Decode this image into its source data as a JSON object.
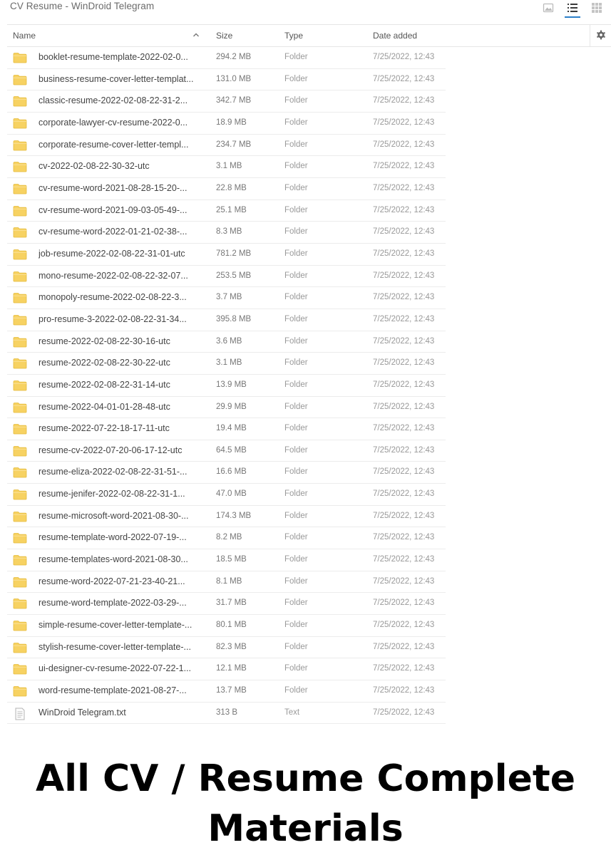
{
  "window": {
    "title": "CV Resume - WinDroid Telegram"
  },
  "toolbar": {
    "icons": [
      "image-view-icon",
      "list-view-icon",
      "grid-view-icon"
    ],
    "active_view": "list"
  },
  "table": {
    "headers": {
      "name": "Name",
      "size": "Size",
      "type": "Type",
      "date": "Date added"
    },
    "sort": "name-ascending",
    "rows": [
      {
        "name": "booklet-resume-template-2022-02-0...",
        "size": "294.2 MB",
        "type": "Folder",
        "date": "7/25/2022, 12:43",
        "icon": "folder-icon"
      },
      {
        "name": "business-resume-cover-letter-templat...",
        "size": "131.0 MB",
        "type": "Folder",
        "date": "7/25/2022, 12:43",
        "icon": "folder-icon"
      },
      {
        "name": "classic-resume-2022-02-08-22-31-2...",
        "size": "342.7 MB",
        "type": "Folder",
        "date": "7/25/2022, 12:43",
        "icon": "folder-icon"
      },
      {
        "name": "corporate-lawyer-cv-resume-2022-0...",
        "size": "18.9 MB",
        "type": "Folder",
        "date": "7/25/2022, 12:43",
        "icon": "folder-icon"
      },
      {
        "name": "corporate-resume-cover-letter-templ...",
        "size": "234.7 MB",
        "type": "Folder",
        "date": "7/25/2022, 12:43",
        "icon": "folder-icon"
      },
      {
        "name": "cv-2022-02-08-22-30-32-utc",
        "size": "3.1 MB",
        "type": "Folder",
        "date": "7/25/2022, 12:43",
        "icon": "folder-icon"
      },
      {
        "name": "cv-resume-word-2021-08-28-15-20-...",
        "size": "22.8 MB",
        "type": "Folder",
        "date": "7/25/2022, 12:43",
        "icon": "folder-icon"
      },
      {
        "name": "cv-resume-word-2021-09-03-05-49-...",
        "size": "25.1 MB",
        "type": "Folder",
        "date": "7/25/2022, 12:43",
        "icon": "folder-icon"
      },
      {
        "name": "cv-resume-word-2022-01-21-02-38-...",
        "size": "8.3 MB",
        "type": "Folder",
        "date": "7/25/2022, 12:43",
        "icon": "folder-icon"
      },
      {
        "name": "job-resume-2022-02-08-22-31-01-utc",
        "size": "781.2 MB",
        "type": "Folder",
        "date": "7/25/2022, 12:43",
        "icon": "folder-icon"
      },
      {
        "name": "mono-resume-2022-02-08-22-32-07...",
        "size": "253.5 MB",
        "type": "Folder",
        "date": "7/25/2022, 12:43",
        "icon": "folder-icon"
      },
      {
        "name": "monopoly-resume-2022-02-08-22-3...",
        "size": "3.7 MB",
        "type": "Folder",
        "date": "7/25/2022, 12:43",
        "icon": "folder-icon"
      },
      {
        "name": "pro-resume-3-2022-02-08-22-31-34...",
        "size": "395.8 MB",
        "type": "Folder",
        "date": "7/25/2022, 12:43",
        "icon": "folder-icon"
      },
      {
        "name": "resume-2022-02-08-22-30-16-utc",
        "size": "3.6 MB",
        "type": "Folder",
        "date": "7/25/2022, 12:43",
        "icon": "folder-icon"
      },
      {
        "name": "resume-2022-02-08-22-30-22-utc",
        "size": "3.1 MB",
        "type": "Folder",
        "date": "7/25/2022, 12:43",
        "icon": "folder-icon"
      },
      {
        "name": "resume-2022-02-08-22-31-14-utc",
        "size": "13.9 MB",
        "type": "Folder",
        "date": "7/25/2022, 12:43",
        "icon": "folder-icon"
      },
      {
        "name": "resume-2022-04-01-01-28-48-utc",
        "size": "29.9 MB",
        "type": "Folder",
        "date": "7/25/2022, 12:43",
        "icon": "folder-icon"
      },
      {
        "name": "resume-2022-07-22-18-17-11-utc",
        "size": "19.4 MB",
        "type": "Folder",
        "date": "7/25/2022, 12:43",
        "icon": "folder-icon"
      },
      {
        "name": "resume-cv-2022-07-20-06-17-12-utc",
        "size": "64.5 MB",
        "type": "Folder",
        "date": "7/25/2022, 12:43",
        "icon": "folder-icon"
      },
      {
        "name": "resume-eliza-2022-02-08-22-31-51-...",
        "size": "16.6 MB",
        "type": "Folder",
        "date": "7/25/2022, 12:43",
        "icon": "folder-icon"
      },
      {
        "name": "resume-jenifer-2022-02-08-22-31-1...",
        "size": "47.0 MB",
        "type": "Folder",
        "date": "7/25/2022, 12:43",
        "icon": "folder-icon"
      },
      {
        "name": "resume-microsoft-word-2021-08-30-...",
        "size": "174.3 MB",
        "type": "Folder",
        "date": "7/25/2022, 12:43",
        "icon": "folder-icon"
      },
      {
        "name": "resume-template-word-2022-07-19-...",
        "size": "8.2 MB",
        "type": "Folder",
        "date": "7/25/2022, 12:43",
        "icon": "folder-icon"
      },
      {
        "name": "resume-templates-word-2021-08-30...",
        "size": "18.5 MB",
        "type": "Folder",
        "date": "7/25/2022, 12:43",
        "icon": "folder-icon"
      },
      {
        "name": "resume-word-2022-07-21-23-40-21...",
        "size": "8.1 MB",
        "type": "Folder",
        "date": "7/25/2022, 12:43",
        "icon": "folder-icon"
      },
      {
        "name": "resume-word-template-2022-03-29-...",
        "size": "31.7 MB",
        "type": "Folder",
        "date": "7/25/2022, 12:43",
        "icon": "folder-icon"
      },
      {
        "name": "simple-resume-cover-letter-template-...",
        "size": "80.1 MB",
        "type": "Folder",
        "date": "7/25/2022, 12:43",
        "icon": "folder-icon"
      },
      {
        "name": "stylish-resume-cover-letter-template-...",
        "size": "82.3 MB",
        "type": "Folder",
        "date": "7/25/2022, 12:43",
        "icon": "folder-icon"
      },
      {
        "name": "ui-designer-cv-resume-2022-07-22-1...",
        "size": "12.1 MB",
        "type": "Folder",
        "date": "7/25/2022, 12:43",
        "icon": "folder-icon"
      },
      {
        "name": "word-resume-template-2021-08-27-...",
        "size": "13.7 MB",
        "type": "Folder",
        "date": "7/25/2022, 12:43",
        "icon": "folder-icon"
      },
      {
        "name": "WinDroid Telegram.txt",
        "size": "313 B",
        "type": "Text",
        "date": "7/25/2022, 12:43",
        "icon": "text-file-icon"
      }
    ]
  },
  "caption": {
    "line1": "All CV / Resume Complete",
    "line2": "Materials"
  },
  "colors": {
    "folder": "#f7d262",
    "accent": "#2b7fc9"
  }
}
